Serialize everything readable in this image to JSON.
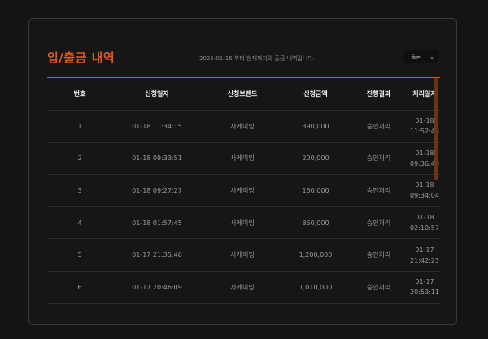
{
  "title": "입/출금 내역",
  "notice": "2025-01-16 부터 현재까지의 출금 내역입니다.",
  "filter": {
    "selected": "출금"
  },
  "table": {
    "headers": [
      "번호",
      "신청일자",
      "신청브랜드",
      "신청금액",
      "진행결과",
      "처리일자"
    ],
    "rows": [
      {
        "no": "1",
        "requested": "01-18 11:34:15",
        "brand": "사게이밍",
        "amount": "390,000",
        "result": "승인처리",
        "processed_date": "01-18",
        "processed_time": "11:52:48"
      },
      {
        "no": "2",
        "requested": "01-18 09:33:51",
        "brand": "사게이밍",
        "amount": "200,000",
        "result": "승인처리",
        "processed_date": "01-18",
        "processed_time": "09:36:48"
      },
      {
        "no": "3",
        "requested": "01-18 09:27:27",
        "brand": "사게이밍",
        "amount": "150,000",
        "result": "승인처리",
        "processed_date": "01-18",
        "processed_time": "09:34:04"
      },
      {
        "no": "4",
        "requested": "01-18 01:57:45",
        "brand": "사게이밍",
        "amount": "860,000",
        "result": "승인처리",
        "processed_date": "01-18",
        "processed_time": "02:10:57"
      },
      {
        "no": "5",
        "requested": "01-17 21:35:46",
        "brand": "사게이밍",
        "amount": "1,200,000",
        "result": "승인처리",
        "processed_date": "01-17",
        "processed_time": "21:42:23"
      },
      {
        "no": "6",
        "requested": "01-17 20:46:09",
        "brand": "사게이밍",
        "amount": "1,010,000",
        "result": "승인처리",
        "processed_date": "01-17",
        "processed_time": "20:53:11"
      }
    ]
  },
  "colors": {
    "accent": "#e0581b",
    "background": "#141414"
  }
}
